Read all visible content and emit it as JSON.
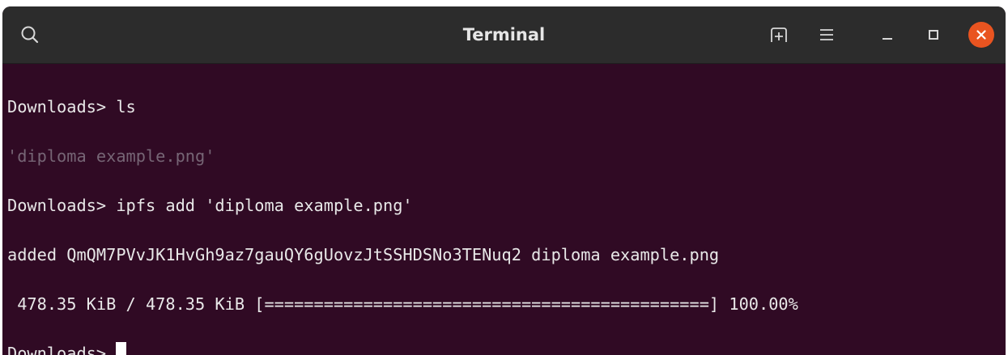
{
  "window": {
    "title": "Terminal",
    "icons": {
      "search": "search-icon",
      "new_tab": "new-tab-icon",
      "menu": "hamburger-menu-icon",
      "minimize": "minimize-icon",
      "maximize": "maximize-icon",
      "close": "close-icon"
    },
    "colors": {
      "titlebar": "#2c2c2c",
      "terminal_bg": "#300a24",
      "close_button": "#e95420",
      "text": "#e8e8e8",
      "filename_text": "#766575"
    }
  },
  "terminal": {
    "lines": [
      "Downloads> ls",
      "'diploma example.png'",
      "Downloads> ipfs add 'diploma example.png'",
      "added QmQM7PVvJK1HvGh9az7gauQY6gUovzJtSSHDSNo3TENuq2 diploma example.png",
      " 478.35 KiB / 478.35 KiB [=============================================] 100.00%",
      "Downloads> "
    ],
    "progress_percent": 100
  }
}
